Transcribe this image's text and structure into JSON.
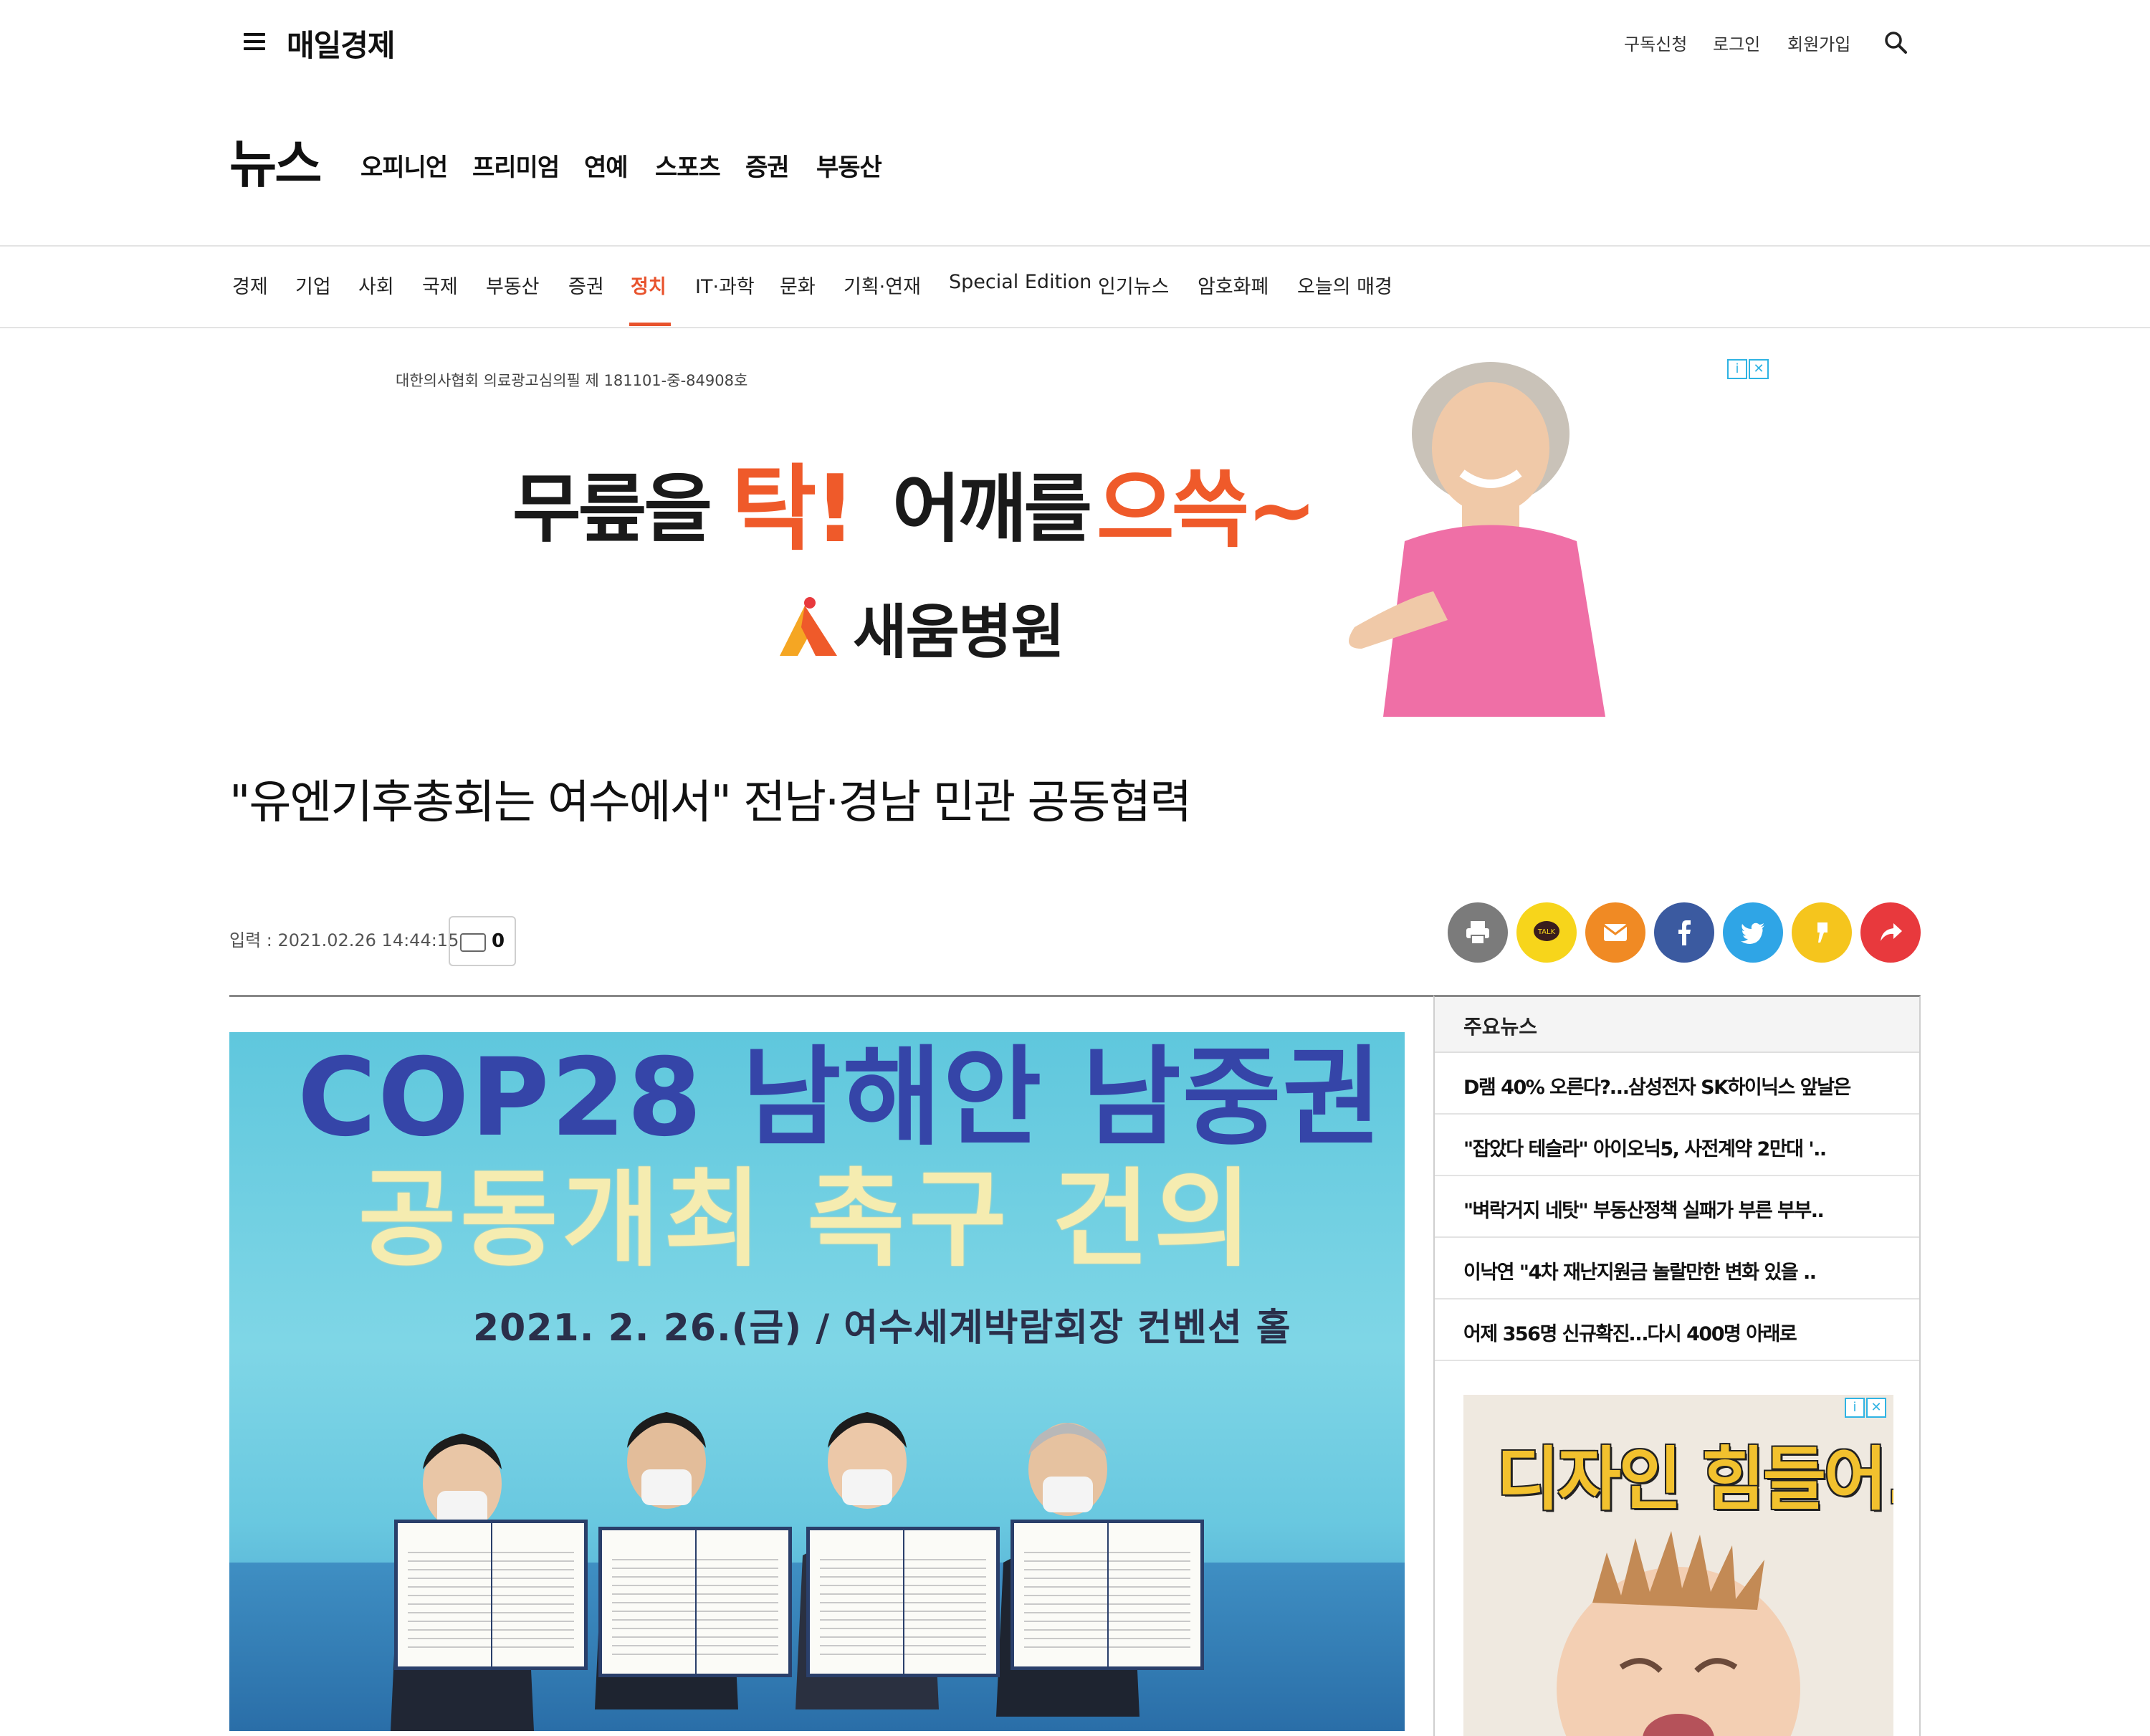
{
  "header": {
    "logo": "매일경제",
    "utility_links": [
      "구독신청",
      "로그인",
      "회원가입"
    ]
  },
  "section_nav": {
    "title": "뉴스",
    "links": [
      "오피니언",
      "프리미엄",
      "연예",
      "스포츠",
      "증권",
      "부동산"
    ]
  },
  "category_nav": {
    "items": [
      "경제",
      "기업",
      "사회",
      "국제",
      "부동산",
      "증권",
      "정치",
      "IT·과학",
      "문화",
      "기획·연재",
      "Special Edition",
      "인기뉴스",
      "암호화폐",
      "오늘의 매경"
    ],
    "active": "정치",
    "active_color": "#e8532d"
  },
  "banner_ad": {
    "disclaimer": "대한의사협회 의료광고심의필 제 181101-중-84908호",
    "headline_1": "무릎을",
    "headline_2": "탁!",
    "headline_3": "어깨를",
    "headline_4": "으쓱~",
    "hospital_name": "새움병원",
    "badge_info": "i",
    "badge_close": "✕"
  },
  "article": {
    "headline": "\"유엔기후총회는 여수에서\" 전남·경남 민관 공동협력",
    "date_label": "입력 : 2021.02.26 14:44:15",
    "comment_count": "0",
    "photo": {
      "line1": "COP28 남해안 남중권",
      "line2": "공동개최 촉구 건의",
      "line3": "2021. 2. 26.(금) / 여수세계박람회장 컨벤션 홀"
    }
  },
  "share_buttons": [
    {
      "name": "print",
      "icon": "printer-icon",
      "color": "#7b7b7b"
    },
    {
      "name": "kakaotalk",
      "icon": "kakaotalk-icon",
      "color": "#f7d51b"
    },
    {
      "name": "email",
      "icon": "mail-icon",
      "color": "#f08a24"
    },
    {
      "name": "facebook",
      "icon": "facebook-icon",
      "color": "#3b5aa0"
    },
    {
      "name": "twitter",
      "icon": "twitter-icon",
      "color": "#2fa5e6"
    },
    {
      "name": "kakaostory",
      "icon": "kakaostory-icon",
      "color": "#f5c51d"
    },
    {
      "name": "share",
      "icon": "share-arrow-icon",
      "color": "#e8393d"
    }
  ],
  "sidebar": {
    "title": "주요뉴스",
    "news": [
      "D램 40% 오른다?…삼성전자 SK하이닉스 앞날은",
      "\"잡았다 테슬라\" 아이오닉5, 사전계약 2만대 '..",
      "\"벼락거지 네탓\" 부동산정책 실패가 부른 부부..",
      "이낙연 \"4차 재난지원금 놀랄만한 변화 있을 ..",
      "어제 356명 신규확진…다시 400명 아래로"
    ],
    "ad_text": "디자인 힘들어."
  }
}
